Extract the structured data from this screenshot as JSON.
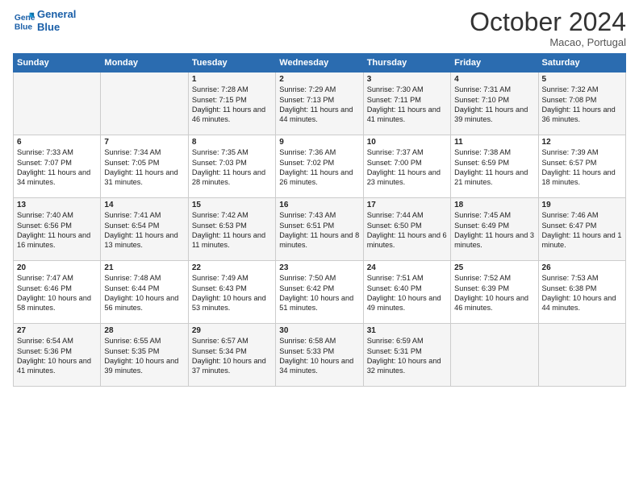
{
  "logo": {
    "line1": "General",
    "line2": "Blue"
  },
  "title": "October 2024",
  "subtitle": "Macao, Portugal",
  "days_header": [
    "Sunday",
    "Monday",
    "Tuesday",
    "Wednesday",
    "Thursday",
    "Friday",
    "Saturday"
  ],
  "weeks": [
    [
      {
        "day": "",
        "sunrise": "",
        "sunset": "",
        "daylight": ""
      },
      {
        "day": "",
        "sunrise": "",
        "sunset": "",
        "daylight": ""
      },
      {
        "day": "1",
        "sunrise": "Sunrise: 7:28 AM",
        "sunset": "Sunset: 7:15 PM",
        "daylight": "Daylight: 11 hours and 46 minutes."
      },
      {
        "day": "2",
        "sunrise": "Sunrise: 7:29 AM",
        "sunset": "Sunset: 7:13 PM",
        "daylight": "Daylight: 11 hours and 44 minutes."
      },
      {
        "day": "3",
        "sunrise": "Sunrise: 7:30 AM",
        "sunset": "Sunset: 7:11 PM",
        "daylight": "Daylight: 11 hours and 41 minutes."
      },
      {
        "day": "4",
        "sunrise": "Sunrise: 7:31 AM",
        "sunset": "Sunset: 7:10 PM",
        "daylight": "Daylight: 11 hours and 39 minutes."
      },
      {
        "day": "5",
        "sunrise": "Sunrise: 7:32 AM",
        "sunset": "Sunset: 7:08 PM",
        "daylight": "Daylight: 11 hours and 36 minutes."
      }
    ],
    [
      {
        "day": "6",
        "sunrise": "Sunrise: 7:33 AM",
        "sunset": "Sunset: 7:07 PM",
        "daylight": "Daylight: 11 hours and 34 minutes."
      },
      {
        "day": "7",
        "sunrise": "Sunrise: 7:34 AM",
        "sunset": "Sunset: 7:05 PM",
        "daylight": "Daylight: 11 hours and 31 minutes."
      },
      {
        "day": "8",
        "sunrise": "Sunrise: 7:35 AM",
        "sunset": "Sunset: 7:03 PM",
        "daylight": "Daylight: 11 hours and 28 minutes."
      },
      {
        "day": "9",
        "sunrise": "Sunrise: 7:36 AM",
        "sunset": "Sunset: 7:02 PM",
        "daylight": "Daylight: 11 hours and 26 minutes."
      },
      {
        "day": "10",
        "sunrise": "Sunrise: 7:37 AM",
        "sunset": "Sunset: 7:00 PM",
        "daylight": "Daylight: 11 hours and 23 minutes."
      },
      {
        "day": "11",
        "sunrise": "Sunrise: 7:38 AM",
        "sunset": "Sunset: 6:59 PM",
        "daylight": "Daylight: 11 hours and 21 minutes."
      },
      {
        "day": "12",
        "sunrise": "Sunrise: 7:39 AM",
        "sunset": "Sunset: 6:57 PM",
        "daylight": "Daylight: 11 hours and 18 minutes."
      }
    ],
    [
      {
        "day": "13",
        "sunrise": "Sunrise: 7:40 AM",
        "sunset": "Sunset: 6:56 PM",
        "daylight": "Daylight: 11 hours and 16 minutes."
      },
      {
        "day": "14",
        "sunrise": "Sunrise: 7:41 AM",
        "sunset": "Sunset: 6:54 PM",
        "daylight": "Daylight: 11 hours and 13 minutes."
      },
      {
        "day": "15",
        "sunrise": "Sunrise: 7:42 AM",
        "sunset": "Sunset: 6:53 PM",
        "daylight": "Daylight: 11 hours and 11 minutes."
      },
      {
        "day": "16",
        "sunrise": "Sunrise: 7:43 AM",
        "sunset": "Sunset: 6:51 PM",
        "daylight": "Daylight: 11 hours and 8 minutes."
      },
      {
        "day": "17",
        "sunrise": "Sunrise: 7:44 AM",
        "sunset": "Sunset: 6:50 PM",
        "daylight": "Daylight: 11 hours and 6 minutes."
      },
      {
        "day": "18",
        "sunrise": "Sunrise: 7:45 AM",
        "sunset": "Sunset: 6:49 PM",
        "daylight": "Daylight: 11 hours and 3 minutes."
      },
      {
        "day": "19",
        "sunrise": "Sunrise: 7:46 AM",
        "sunset": "Sunset: 6:47 PM",
        "daylight": "Daylight: 11 hours and 1 minute."
      }
    ],
    [
      {
        "day": "20",
        "sunrise": "Sunrise: 7:47 AM",
        "sunset": "Sunset: 6:46 PM",
        "daylight": "Daylight: 10 hours and 58 minutes."
      },
      {
        "day": "21",
        "sunrise": "Sunrise: 7:48 AM",
        "sunset": "Sunset: 6:44 PM",
        "daylight": "Daylight: 10 hours and 56 minutes."
      },
      {
        "day": "22",
        "sunrise": "Sunrise: 7:49 AM",
        "sunset": "Sunset: 6:43 PM",
        "daylight": "Daylight: 10 hours and 53 minutes."
      },
      {
        "day": "23",
        "sunrise": "Sunrise: 7:50 AM",
        "sunset": "Sunset: 6:42 PM",
        "daylight": "Daylight: 10 hours and 51 minutes."
      },
      {
        "day": "24",
        "sunrise": "Sunrise: 7:51 AM",
        "sunset": "Sunset: 6:40 PM",
        "daylight": "Daylight: 10 hours and 49 minutes."
      },
      {
        "day": "25",
        "sunrise": "Sunrise: 7:52 AM",
        "sunset": "Sunset: 6:39 PM",
        "daylight": "Daylight: 10 hours and 46 minutes."
      },
      {
        "day": "26",
        "sunrise": "Sunrise: 7:53 AM",
        "sunset": "Sunset: 6:38 PM",
        "daylight": "Daylight: 10 hours and 44 minutes."
      }
    ],
    [
      {
        "day": "27",
        "sunrise": "Sunrise: 6:54 AM",
        "sunset": "Sunset: 5:36 PM",
        "daylight": "Daylight: 10 hours and 41 minutes."
      },
      {
        "day": "28",
        "sunrise": "Sunrise: 6:55 AM",
        "sunset": "Sunset: 5:35 PM",
        "daylight": "Daylight: 10 hours and 39 minutes."
      },
      {
        "day": "29",
        "sunrise": "Sunrise: 6:57 AM",
        "sunset": "Sunset: 5:34 PM",
        "daylight": "Daylight: 10 hours and 37 minutes."
      },
      {
        "day": "30",
        "sunrise": "Sunrise: 6:58 AM",
        "sunset": "Sunset: 5:33 PM",
        "daylight": "Daylight: 10 hours and 34 minutes."
      },
      {
        "day": "31",
        "sunrise": "Sunrise: 6:59 AM",
        "sunset": "Sunset: 5:31 PM",
        "daylight": "Daylight: 10 hours and 32 minutes."
      },
      {
        "day": "",
        "sunrise": "",
        "sunset": "",
        "daylight": ""
      },
      {
        "day": "",
        "sunrise": "",
        "sunset": "",
        "daylight": ""
      }
    ]
  ]
}
